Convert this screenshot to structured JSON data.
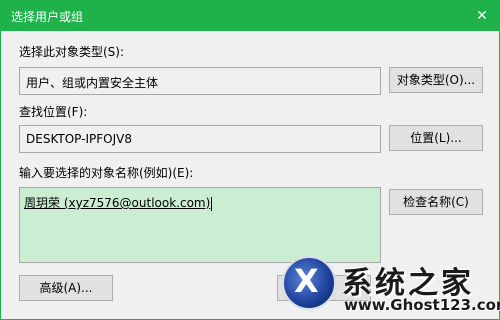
{
  "window": {
    "title": "选择用户或组",
    "close_glyph": "✕"
  },
  "object_type": {
    "label": "选择此对象类型(S):",
    "value": "用户、组或内置安全主体",
    "button": "对象类型(O)..."
  },
  "location": {
    "label": "查找位置(F):",
    "value": "DESKTOP-IPFOJV8",
    "button": "位置(L)..."
  },
  "names": {
    "label": "输入要选择的对象名称(例如)(E):",
    "value": "周玥荣 (xyz7576@outlook.com)",
    "button": "检查名称(C)"
  },
  "advanced_button": "高级(A)...",
  "ok_button": "",
  "watermark": {
    "title": "系统之家",
    "url": "www.Ghost123.com",
    "logo_glyph": "X"
  },
  "colors": {
    "titlebar": "#1fb24a",
    "name_box_bg": "#cbeed2"
  }
}
